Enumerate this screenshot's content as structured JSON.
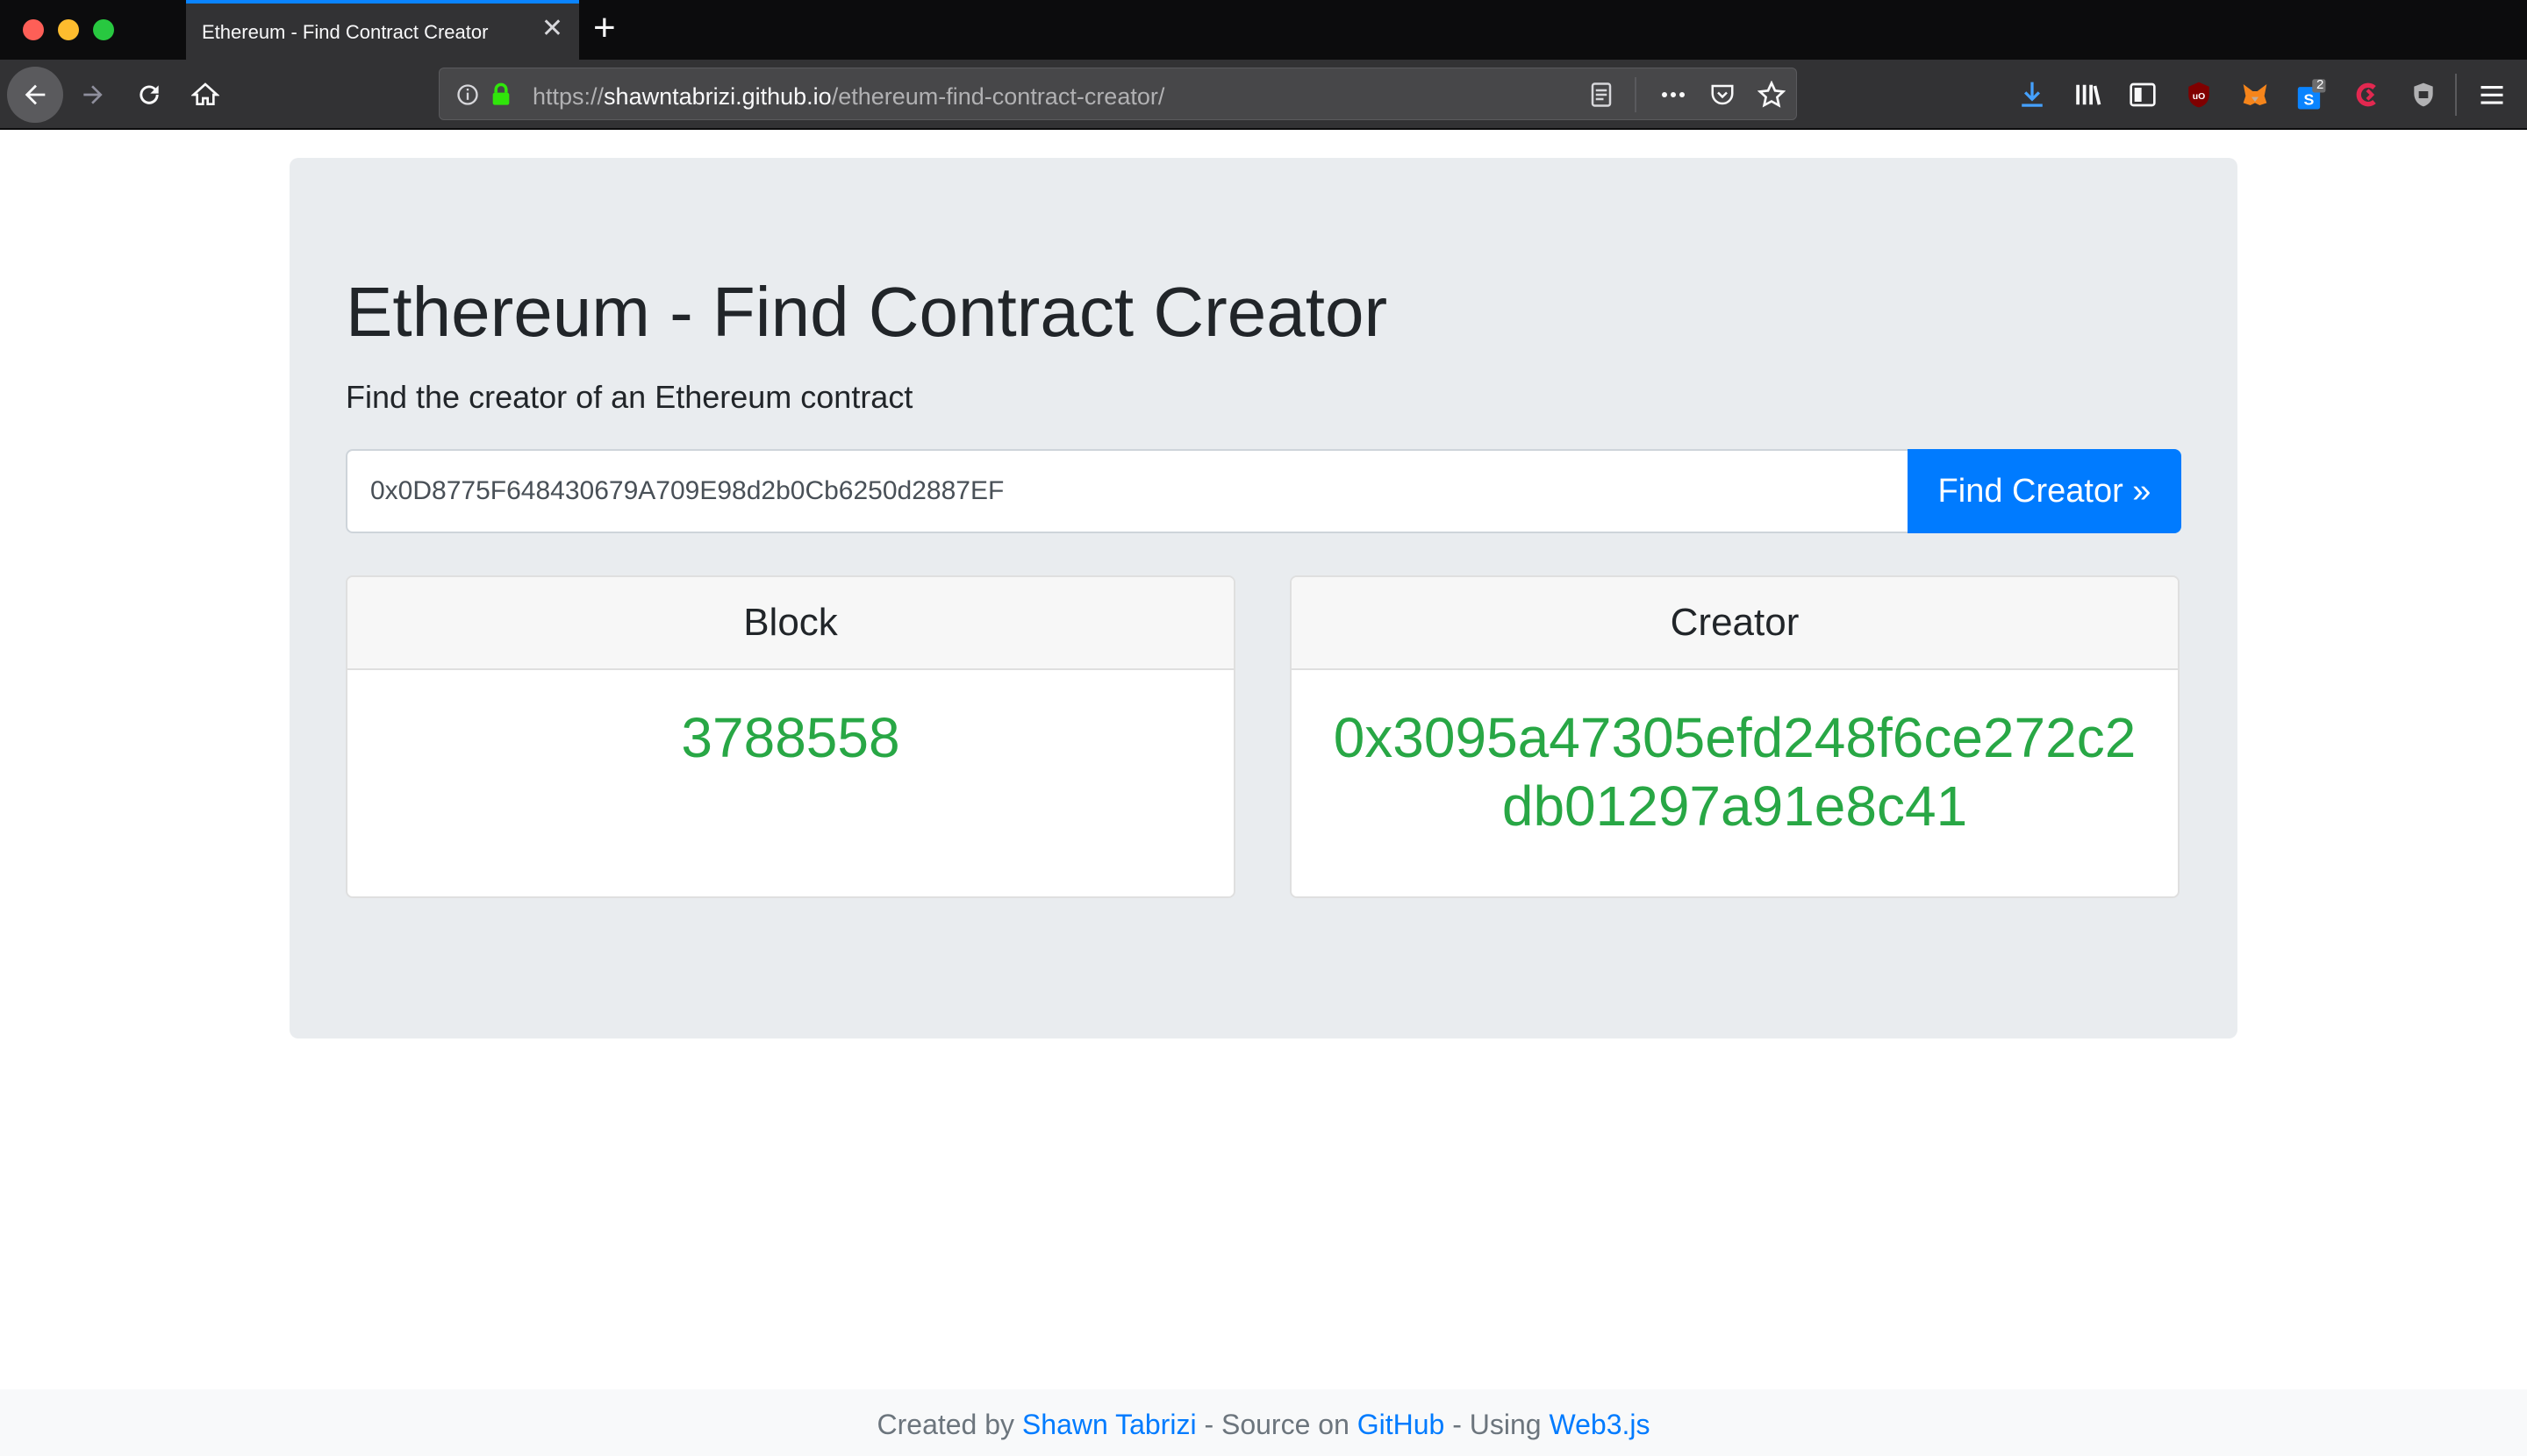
{
  "browser": {
    "tab_title": "Ethereum - Find Contract Creator",
    "url_prefix": "https://",
    "url_host": "shawntabrizi.github.io",
    "url_path": "/ethereum-find-contract-creator/",
    "badge_count": "2"
  },
  "page": {
    "title": "Ethereum - Find Contract Creator",
    "subtitle": "Find the creator of an Ethereum contract",
    "address_value": "0x0D8775F648430679A709E98d2b0Cb6250d2887EF",
    "button_label": "Find Creator »"
  },
  "cards": {
    "block": {
      "header": "Block",
      "value": "3788558"
    },
    "creator": {
      "header": "Creator",
      "value": "0x3095a47305efd248f6ce272c2db01297a91e8c41"
    }
  },
  "footer": {
    "created_by": "Created by ",
    "author": "Shawn Tabrizi",
    "source_on": " - Source on ",
    "github": "GitHub",
    "using": " - Using ",
    "web3": "Web3.js"
  },
  "colors": {
    "accent": "#007bff",
    "success": "#28a745",
    "jumbotron_bg": "#e9ecef"
  }
}
